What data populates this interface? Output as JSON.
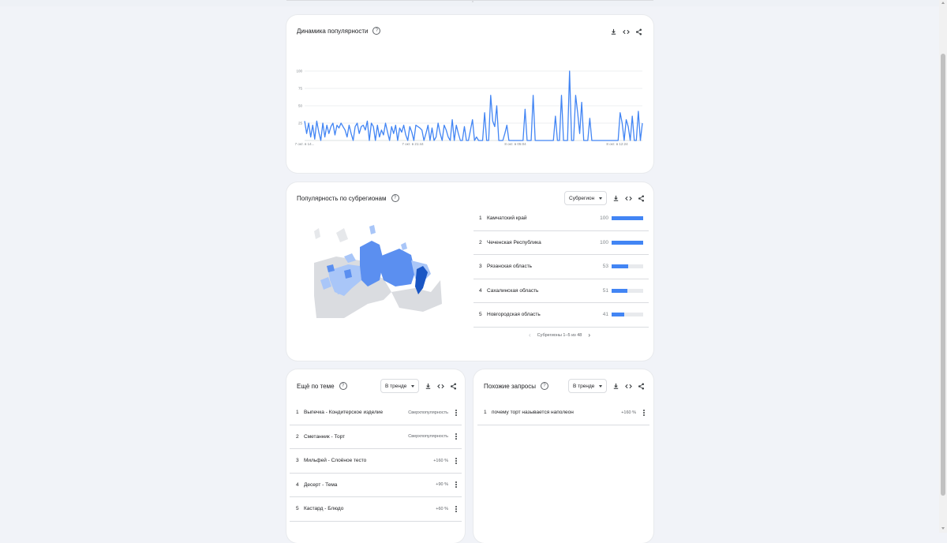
{
  "trend_card": {
    "title": "Динамика популярности",
    "icons": [
      "download-icon",
      "embed-icon",
      "share-icon"
    ]
  },
  "chart_data": {
    "type": "line",
    "ylim": [
      0,
      100
    ],
    "y_ticks": [
      "100",
      "75",
      "50",
      "25"
    ],
    "x_ticks": [
      "7 окт. в 14...",
      "7 окт. в 21:44",
      "8 окт. в 05:04",
      "8 окт. в 12:24"
    ],
    "series_color": "#4285f4",
    "values": [
      28,
      10,
      25,
      5,
      22,
      2,
      28,
      12,
      0,
      25,
      5,
      22,
      10,
      20,
      25,
      8,
      22,
      18,
      25,
      20,
      15,
      5,
      22,
      10,
      0,
      20,
      25,
      10,
      20,
      22,
      15,
      28,
      0,
      25,
      20,
      0,
      22,
      5,
      15,
      8,
      25,
      12,
      0,
      20,
      10,
      22,
      0,
      18,
      12,
      22,
      8,
      0,
      20,
      12,
      0,
      22,
      20,
      18,
      15,
      0,
      10,
      22,
      0,
      18,
      0,
      5,
      25,
      10,
      0,
      22,
      15,
      5,
      0,
      30,
      0,
      22,
      10,
      0,
      0,
      20,
      0,
      0,
      15,
      30,
      0,
      5,
      0,
      0,
      0,
      40,
      0,
      0,
      65,
      28,
      20,
      50,
      0,
      0,
      0,
      10,
      22,
      0,
      0,
      0,
      0,
      0,
      0,
      0,
      0,
      45,
      0,
      0,
      0,
      65,
      0,
      0,
      0,
      0,
      0,
      0,
      0,
      0,
      0,
      0,
      35,
      0,
      0,
      65,
      0,
      0,
      0,
      100,
      0,
      0,
      65,
      40,
      10,
      55,
      0,
      0,
      0,
      32,
      0,
      0,
      0,
      0,
      0,
      0,
      0,
      0,
      0,
      0,
      0,
      0,
      0,
      0,
      40,
      25,
      0,
      30,
      20,
      0,
      35,
      0,
      0,
      42,
      0,
      25
    ]
  },
  "subregion_card": {
    "title": "Популярность по субрегионам",
    "dropdown": "Субрегион",
    "icons": [
      "download-icon",
      "embed-icon",
      "share-icon"
    ],
    "rows": [
      {
        "num": "1",
        "name": "Камчатский край",
        "value": "100",
        "pct": 100
      },
      {
        "num": "2",
        "name": "Чеченская Республика",
        "value": "100",
        "pct": 100
      },
      {
        "num": "3",
        "name": "Рязанская область",
        "value": "53",
        "pct": 53
      },
      {
        "num": "4",
        "name": "Сахалинская область",
        "value": "51",
        "pct": 51
      },
      {
        "num": "5",
        "name": "Новгородская область",
        "value": "41",
        "pct": 41
      }
    ],
    "pager": "Субрегионы 1–5 из 48"
  },
  "topics_card": {
    "title": "Ещё по теме",
    "dropdown": "В тренде",
    "icons": [
      "download-icon",
      "embed-icon",
      "share-icon"
    ],
    "rows": [
      {
        "num": "1",
        "name": "Выпечка - Кондитерское изделие",
        "value": "Сверхпопулярность"
      },
      {
        "num": "2",
        "name": "Сметанник - Торт",
        "value": "Сверхпопулярность"
      },
      {
        "num": "3",
        "name": "Мильфей - Слоёное тесто",
        "value": "+160 %"
      },
      {
        "num": "4",
        "name": "Десерт - Тема",
        "value": "+90 %"
      },
      {
        "num": "5",
        "name": "Кастард - Блюдо",
        "value": "+60 %"
      }
    ]
  },
  "queries_card": {
    "title": "Похожие запросы",
    "dropdown": "В тренде",
    "icons": [
      "download-icon",
      "embed-icon",
      "share-icon"
    ],
    "rows": [
      {
        "num": "1",
        "name": "почему торт называется наполеон",
        "value": "+160 %"
      }
    ]
  },
  "colors": {
    "accent": "#4285f4",
    "map_dark": "#1a56c4",
    "map_mid": "#5b8ff0",
    "map_light": "#a9c6f8",
    "map_empty": "#dadce0"
  }
}
